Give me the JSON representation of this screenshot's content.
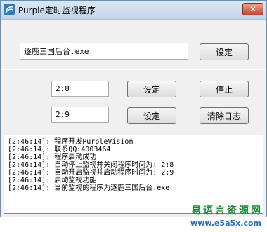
{
  "window": {
    "title": "Purple定时监视程序",
    "close_symbol": "✕"
  },
  "main": {
    "program_name": "逐鹿三国后台.exe",
    "set_program_label": "设定",
    "stop_time": "2:8",
    "set_stop_label": "设定",
    "stop_label": "停止",
    "start_time": "2:9",
    "set_start_label": "设定",
    "clear_log_label": "清除日志"
  },
  "log": {
    "lines": [
      "[2:46:14]: 程序开发PurpleVision",
      "[2:46:14]: 联系QQ:4003464",
      "[2:46:14]: 程序启动成功",
      "[2:46:14]: 自动停止监视并关闭程序时间为: 2:8",
      "[2:46:14]: 自动开启监视并启动程序时间为: 2:9",
      "[2:46:14]: 启动监视功能",
      "[2:46:14]: 当前监视的程序为逐鹿三国后台.exe"
    ]
  },
  "watermark": {
    "title": "易语言资源网",
    "url": "www.e5a5x.com"
  },
  "icons": {
    "app": "app-logo-icon",
    "close": "close-icon"
  },
  "colors": {
    "watermark_green": "#1f8a3b",
    "watermark_blue": "#2e6fb0",
    "close_red": "#c7452e"
  }
}
